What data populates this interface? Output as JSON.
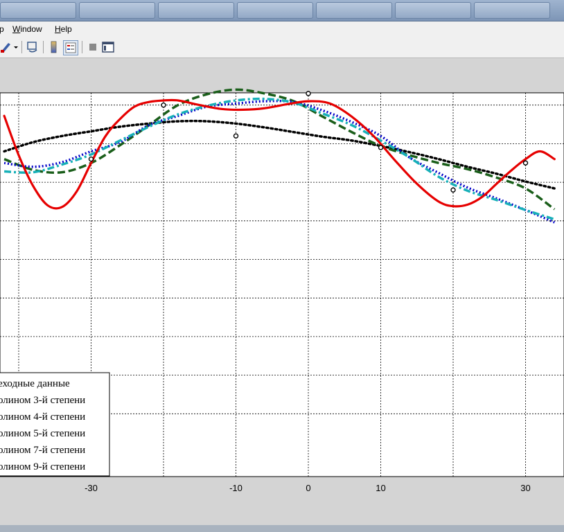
{
  "menu": {
    "items": [
      {
        "id": "partial",
        "label": "p",
        "accel": ""
      },
      {
        "id": "window",
        "label": "indow",
        "accel": "W"
      },
      {
        "id": "help",
        "label": "elp",
        "accel": "H"
      }
    ]
  },
  "toolbar": {
    "icons": [
      "brush-icon",
      "dropdown-arrow-icon",
      "link-plot-icon",
      "colorbar-icon",
      "legend-icon",
      "hide-plot-tools-icon",
      "show-plot-tools-icon"
    ]
  },
  "colors": {
    "background": "#d4d4d4",
    "axes": "#ffffff",
    "poly3": "#000000",
    "poly4": "#1a5e1a",
    "poly5": "#0000c8",
    "poly7": "#17b0b8",
    "poly9": "#e60000"
  },
  "chart_data": {
    "type": "line",
    "xlim": [
      -42,
      35
    ],
    "ylim": [
      -4.6,
      0.55
    ],
    "x_ticks": [
      -30,
      -10,
      0,
      10,
      30
    ],
    "x_tick_labels": [
      "-30",
      "-10",
      "0",
      "10",
      "30"
    ],
    "grid": true,
    "legend_position": "bottom-left",
    "legend": [
      "еходные данные",
      "олином 3-й степени",
      "олином 4-й степени",
      "олином 5-й степени",
      "олином 7-й степени",
      "олином 9-й степени"
    ],
    "source_points": {
      "x": [
        -30,
        -20,
        -10,
        0,
        10,
        20,
        30
      ],
      "y": [
        -1.2,
        -0.5,
        -0.9,
        -0.35,
        -1.05,
        -1.6,
        -1.25
      ]
    },
    "series": [
      {
        "x": [
          -42,
          -38,
          -34,
          -30,
          -26,
          -22,
          -18,
          -14,
          -10,
          -6,
          -2,
          2,
          6,
          10,
          14,
          18,
          22,
          26,
          30,
          34
        ],
        "y": [
          -1.1,
          -0.98,
          -0.9,
          -0.84,
          -0.78,
          -0.74,
          -0.71,
          -0.71,
          -0.74,
          -0.79,
          -0.85,
          -0.91,
          -0.96,
          -1.03,
          -1.11,
          -1.2,
          -1.3,
          -1.39,
          -1.49,
          -1.58
        ]
      },
      {
        "x": [
          -42,
          -38,
          -34,
          -30,
          -26,
          -22,
          -18,
          -14,
          -10,
          -6,
          -2,
          2,
          6,
          10,
          14,
          18,
          22,
          26,
          30,
          34
        ],
        "y": [
          -1.2,
          -1.34,
          -1.37,
          -1.25,
          -1.02,
          -0.76,
          -0.5,
          -0.36,
          -0.3,
          -0.35,
          -0.45,
          -0.65,
          -0.85,
          -1.03,
          -1.15,
          -1.25,
          -1.33,
          -1.44,
          -1.58,
          -1.85
        ]
      },
      {
        "x": [
          -42,
          -38,
          -34,
          -30,
          -26,
          -22,
          -18,
          -14,
          -10,
          -6,
          -2,
          2,
          6,
          10,
          14,
          18,
          22,
          26,
          30,
          34
        ],
        "y": [
          -1.25,
          -1.3,
          -1.24,
          -1.1,
          -0.98,
          -0.76,
          -0.64,
          -0.52,
          -0.48,
          -0.45,
          -0.46,
          -0.57,
          -0.72,
          -0.9,
          -1.18,
          -1.38,
          -1.57,
          -1.71,
          -1.86,
          -2.02
        ]
      },
      {
        "x": [
          -42,
          -38,
          -34,
          -30,
          -26,
          -22,
          -18,
          -14,
          -10,
          -6,
          -2,
          2,
          6,
          10,
          14,
          18,
          22,
          26,
          30,
          34
        ],
        "y": [
          -1.36,
          -1.37,
          -1.27,
          -1.14,
          -0.96,
          -0.78,
          -0.62,
          -0.51,
          -0.44,
          -0.42,
          -0.47,
          -0.61,
          -0.76,
          -0.96,
          -1.18,
          -1.43,
          -1.61,
          -1.73,
          -1.86,
          -1.98
        ]
      },
      {
        "x": [
          -42,
          -40,
          -38,
          -36,
          -34,
          -32,
          -30,
          -28,
          -26,
          -24,
          -22,
          -20,
          -18,
          -15,
          -12,
          -9,
          -6,
          -3,
          0,
          3,
          6,
          9,
          12,
          15,
          18,
          20,
          22,
          24,
          26,
          28,
          30,
          32,
          34
        ],
        "y": [
          -0.64,
          -1.15,
          -1.55,
          -1.8,
          -1.82,
          -1.62,
          -1.25,
          -0.9,
          -0.68,
          -0.52,
          -0.46,
          -0.44,
          -0.44,
          -0.5,
          -0.55,
          -0.56,
          -0.54,
          -0.49,
          -0.45,
          -0.48,
          -0.65,
          -0.9,
          -1.22,
          -1.52,
          -1.75,
          -1.81,
          -1.79,
          -1.69,
          -1.52,
          -1.35,
          -1.2,
          -1.1,
          -1.2
        ]
      }
    ]
  }
}
